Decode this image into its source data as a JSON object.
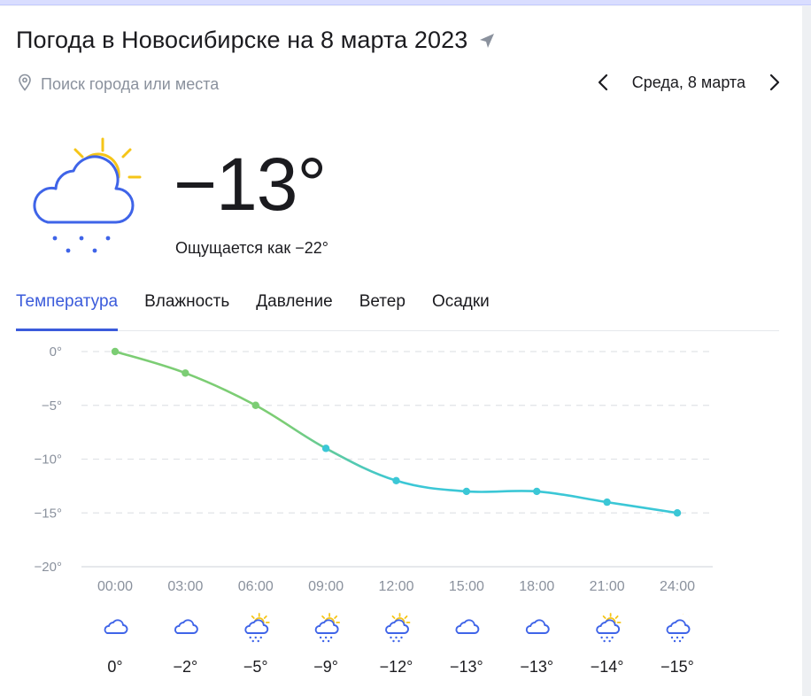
{
  "header": {
    "title": "Погода в Новосибирске на 8 марта 2023",
    "location_icon": "navigation-arrow-icon"
  },
  "search": {
    "placeholder": "Поиск города или места",
    "icon": "map-pin-icon"
  },
  "date_nav": {
    "label": "Среда, 8 марта",
    "prev_icon": "chevron-left-icon",
    "next_icon": "chevron-right-icon"
  },
  "current": {
    "temperature": "−13°",
    "feels_prefix": "Ощущается как",
    "feels_value": "−22°",
    "condition_icon": "partly-cloudy-snow-icon"
  },
  "tabs": [
    {
      "label": "Температура",
      "active": true
    },
    {
      "label": "Влажность",
      "active": false
    },
    {
      "label": "Давление",
      "active": false
    },
    {
      "label": "Ветер",
      "active": false
    },
    {
      "label": "Осадки",
      "active": false
    }
  ],
  "chart_data": {
    "type": "line",
    "title": "",
    "xlabel": "",
    "ylabel": "",
    "x": [
      "00:00",
      "03:00",
      "06:00",
      "09:00",
      "12:00",
      "15:00",
      "18:00",
      "21:00",
      "24:00"
    ],
    "y_ticks": [
      "0°",
      "−5°",
      "−10°",
      "−15°",
      "−20°"
    ],
    "ylim": [
      -20,
      0
    ],
    "grid": true,
    "series": [
      {
        "values": [
          0,
          -2,
          -5,
          -9,
          -12,
          -13,
          -13,
          -14,
          -15
        ]
      }
    ],
    "colors": {
      "warm": "#7ccd74",
      "cold": "#3bc7d6"
    }
  },
  "hourly": [
    {
      "icon": "cloud-icon",
      "temp": "0°"
    },
    {
      "icon": "cloud-icon",
      "temp": "−2°"
    },
    {
      "icon": "sun-cloud-snow-icon",
      "temp": "−5°"
    },
    {
      "icon": "sun-cloud-snow-icon",
      "temp": "−9°"
    },
    {
      "icon": "sun-cloud-snow-icon",
      "temp": "−12°"
    },
    {
      "icon": "cloud-icon",
      "temp": "−13°"
    },
    {
      "icon": "cloud-icon",
      "temp": "−13°"
    },
    {
      "icon": "sun-cloud-snow-icon",
      "temp": "−14°"
    },
    {
      "icon": "moon-cloud-snow-icon",
      "temp": "−15°"
    }
  ],
  "colors": {
    "accent": "#3b5bdb",
    "icon_blue": "#3f64e8",
    "sun": "#f5c518"
  }
}
